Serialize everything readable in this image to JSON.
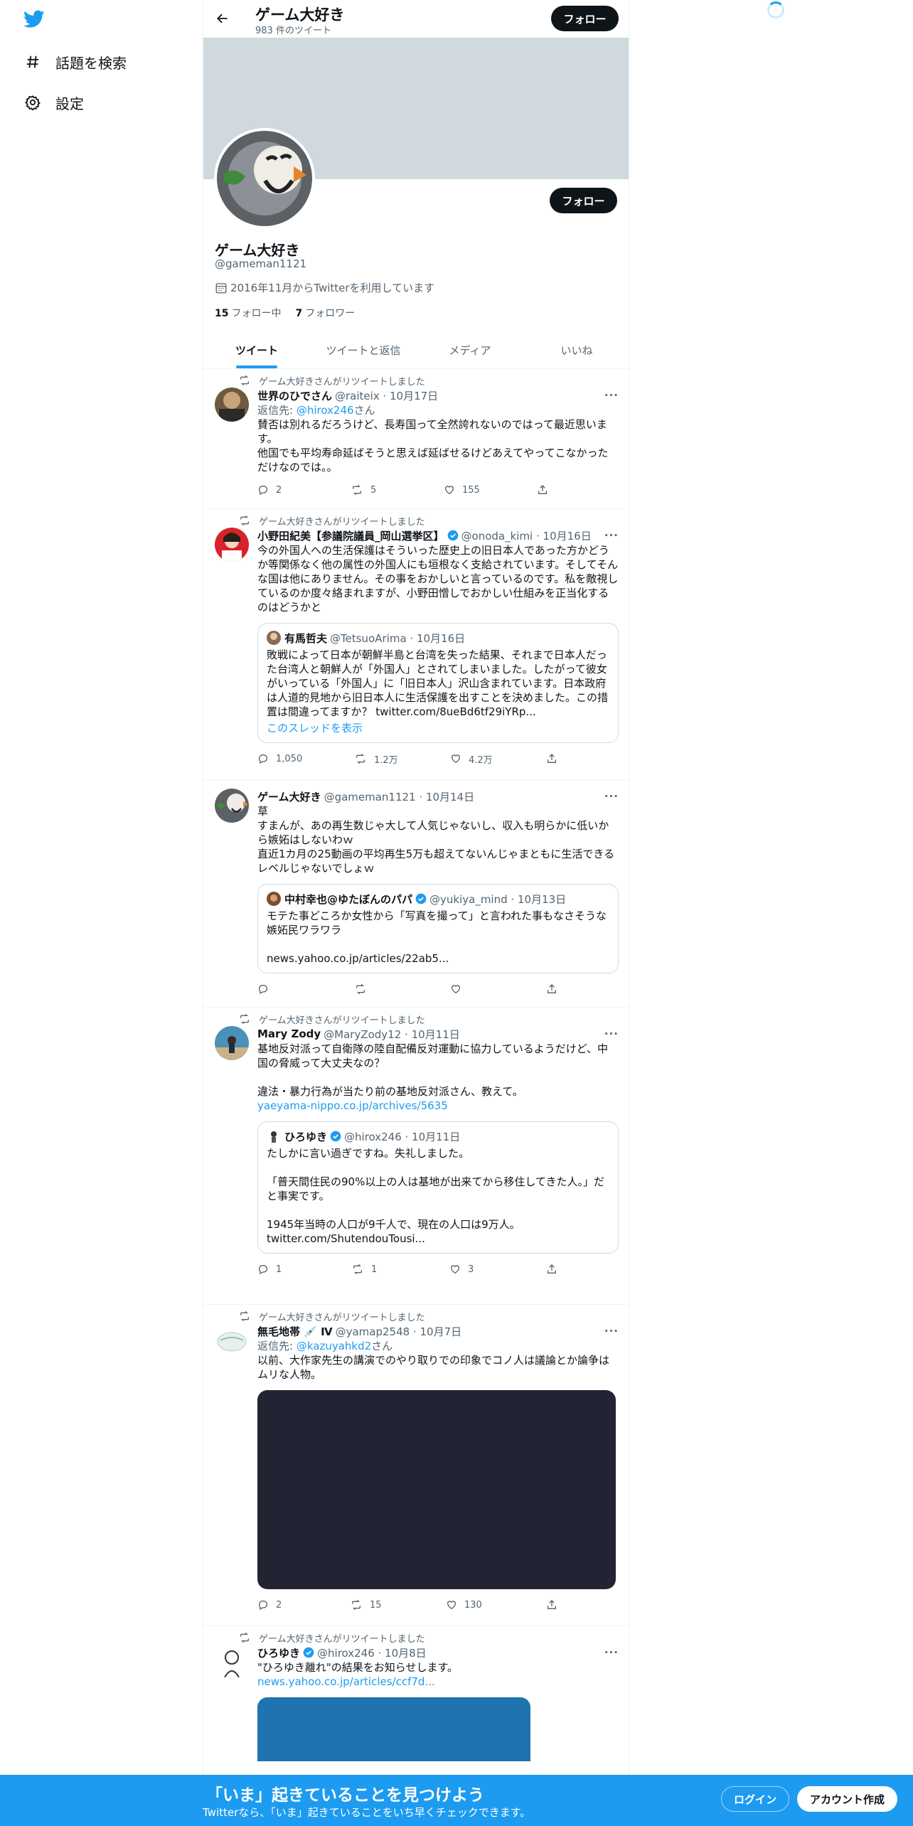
{
  "nav": {
    "items": [
      {
        "label": "話題を検索",
        "icon": "hashtag-icon"
      },
      {
        "label": "設定",
        "icon": "gear-icon"
      }
    ]
  },
  "header": {
    "name": "ゲーム大好き",
    "tweet_count": "983 件のツイート",
    "follow_label": "フォロー"
  },
  "profile": {
    "name": "ゲーム大好き",
    "handle": "@gameman1121",
    "joined": "2016年11月からTwitterを利用しています",
    "following_count": "15",
    "following_label": "フォロー中",
    "followers_count": "7",
    "followers_label": "フォロワー",
    "follow_label": "フォロー"
  },
  "tabs": [
    {
      "label": "ツイート",
      "active": true
    },
    {
      "label": "ツイートと返信",
      "active": false
    },
    {
      "label": "メディア",
      "active": false
    },
    {
      "label": "いいね",
      "active": false
    }
  ],
  "tweets": [
    {
      "retweeted_by": "ゲーム大好きさんがリツイートしました",
      "name": "世界のひでさん",
      "handle": "@raiteix · 10月17日",
      "reply_prefix": "返信先: ",
      "reply_to": "@hirox246",
      "reply_suffix": "さん",
      "text": "賛否は別れるだろうけど、長寿国って全然誇れないのではって最近思います。\n他国でも平均寿命延ばそうと思えば延ばせるけどあえてやってこなかっただけなのでは。。",
      "replies": "2",
      "retweets": "5",
      "likes": "155"
    },
    {
      "retweeted_by": "ゲーム大好きさんがリツイートしました",
      "name": "小野田紀美【参議院議員_岡山選挙区】",
      "handle": "@onoda_kimi · 10月16日",
      "text": "今の外国人への生活保護はそういった歴史上の旧日本人であった方かどうか等関係なく他の属性の外国人にも垣根なく支給されています。そしてそんな国は他にありません。その事をおかしいと言っているのです。私を敵視しているのか度々絡まれますが、小野田憎しでおかしい仕組みを正当化するのはどうかと",
      "quote": {
        "name": "有馬哲夫",
        "handle": "@TetsuoArima · 10月16日",
        "text": "敗戦によって日本が朝鮮半島と台湾を失った結果、それまで日本人だった台湾人と朝鮮人が「外国人」とされてしまいました。したがって彼女がいっている「外国人」に「旧日本人」沢山含まれています。日本政府は人道的見地から旧日本人に生活保護を出すことを決めました。この措置は間違ってますか？ twitter.com/8ueBd6tf29iYRp...",
        "thread": "このスレッドを表示"
      },
      "replies": "1,050",
      "retweets": "1.2万",
      "likes": "4.2万"
    },
    {
      "name": "ゲーム大好き",
      "handle": "@gameman1121 · 10月14日",
      "text": "草\nすまんが、あの再生数じゃ大して人気じゃないし、収入も明らかに低いから嫉妬はしないわｗ\n直近1カ月の25動画の平均再生5万も超えてないんじゃまともに生活できるレベルじゃないでしょｗ",
      "quote": {
        "name": "中村幸也@ゆたぼんのパパ",
        "handle": "@yukiya_mind · 10月13日",
        "text": "モテた事どころか女性から「写真を撮って」と言われた事もなさそうな嫉妬民ワラワラ\n\nnews.yahoo.co.jp/articles/22ab5..."
      },
      "replies": "",
      "retweets": "",
      "likes": ""
    },
    {
      "retweeted_by": "ゲーム大好きさんがリツイートしました",
      "name": "Mary Zody",
      "handle": "@MaryZody12 · 10月11日",
      "text": "基地反対派って自衛隊の陸自配備反対運動に協力しているようだけど、中国の脅威って大丈夫なの？\n\n違法・暴力行為が当たり前の基地反対派さん、教えて。\n",
      "link": "yaeyama-nippo.co.jp/archives/5635",
      "quote": {
        "name": "ひろゆき",
        "handle": "@hirox246 · 10月11日",
        "text": "たしかに言い過ぎですね。失礼しました。\n\n「普天間住民の90%以上の人は基地が出来てから移住してきた人。」だと事実です。\n\n1945年当時の人口が9千人で、現在の人口は9万人。\ntwitter.com/ShutendouTousi..."
      },
      "replies": "1",
      "retweets": "1",
      "likes": "3"
    },
    {
      "retweeted_by": "ゲーム大好きさんがリツイートしました",
      "name": "無毛地帯 💉 Ⅳ",
      "handle": "@yamap2548 · 10月7日",
      "reply_prefix": "返信先: ",
      "reply_to": "@kazuyahkd2",
      "reply_suffix": "さん",
      "text": "以前、大作家先生の講演でのやり取りでの印象でコノ人は議論とか論争はムリな人物。",
      "replies": "2",
      "retweets": "15",
      "likes": "130"
    },
    {
      "retweeted_by": "ゲーム大好きさんがリツイートしました",
      "name": "ひろゆき",
      "handle": "@hirox246 · 10月8日",
      "text": "\"ひろゆき離れ\"の結果をお知らせします。\n",
      "link": "news.yahoo.co.jp/articles/ccf7d..."
    }
  ],
  "bottombar": {
    "title": "「いま」起きていることを見つけよう",
    "subtitle": "Twitterなら、「いま」起きていることをいち早くチェックできます。",
    "login": "ログイン",
    "signup": "アカウント作成"
  },
  "colors": {
    "accent": "#1d9bf0",
    "text": "#0f1419",
    "muted": "#536471",
    "banner": "#cfd9de"
  }
}
